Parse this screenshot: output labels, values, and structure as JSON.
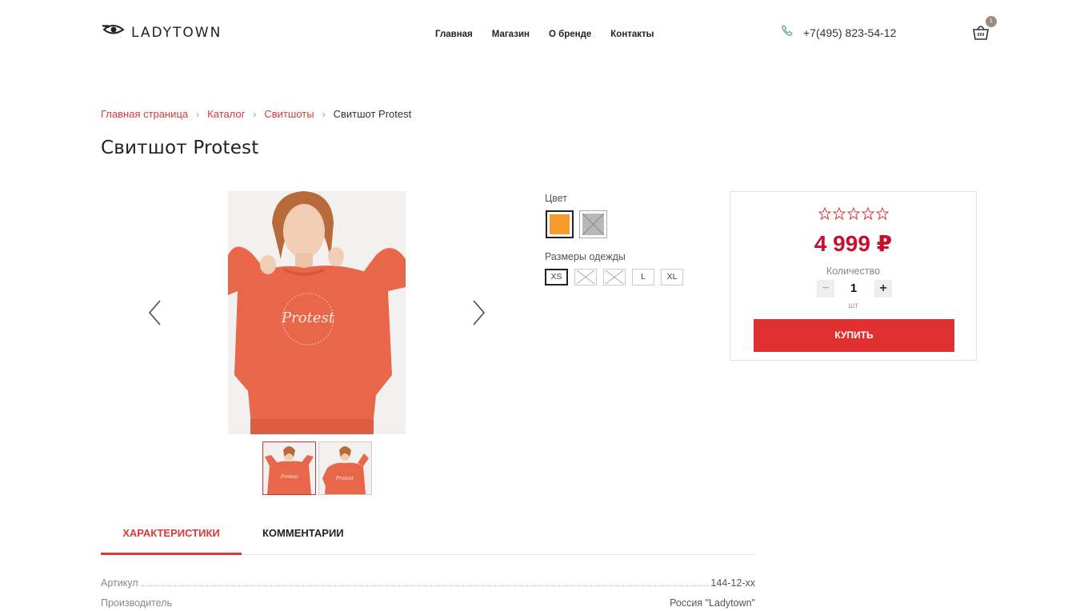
{
  "header": {
    "logo_text": "LADYTOWN",
    "nav": [
      "Главная",
      "Магазин",
      "О бренде",
      "Контакты"
    ],
    "phone": "+7(495) 823-54-12",
    "cart_count": "1"
  },
  "breadcrumb": {
    "items": [
      "Главная страница",
      "Каталог",
      "Свитшоты"
    ],
    "current": "Свитшот Protest"
  },
  "product": {
    "title": "Свитшот Protest",
    "image_print_text": "Protest",
    "color_label": "Цвет",
    "colors": [
      {
        "name": "orange",
        "hex": "#f79a2e",
        "selected": true,
        "available": true
      },
      {
        "name": "gray",
        "hex": "#b8b8b8",
        "selected": false,
        "available": false
      }
    ],
    "sizes_label": "Размеры одежды",
    "sizes": [
      {
        "label": "XS",
        "selected": true,
        "available": true
      },
      {
        "label": "",
        "selected": false,
        "available": false
      },
      {
        "label": "",
        "selected": false,
        "available": false
      },
      {
        "label": "L",
        "selected": false,
        "available": true
      },
      {
        "label": "XL",
        "selected": false,
        "available": true
      }
    ],
    "rating": 0,
    "price": "4 999 ₽",
    "quantity_label": "Количество",
    "quantity": "1",
    "quantity_unit": "шт",
    "buy_label": "КУПИТЬ"
  },
  "tabs": [
    "ХАРАКТЕРИСТИКИ",
    "КОММЕНТАРИИ"
  ],
  "specs": [
    {
      "name": "Артикул",
      "value": "144-12-хх"
    },
    {
      "name": "Производитель",
      "value": "Россия \"Ladytown\""
    }
  ],
  "colors": {
    "accent": "#d63a3a",
    "price": "#c8102e",
    "button": "#e03030",
    "sweater": "#e8674a"
  }
}
